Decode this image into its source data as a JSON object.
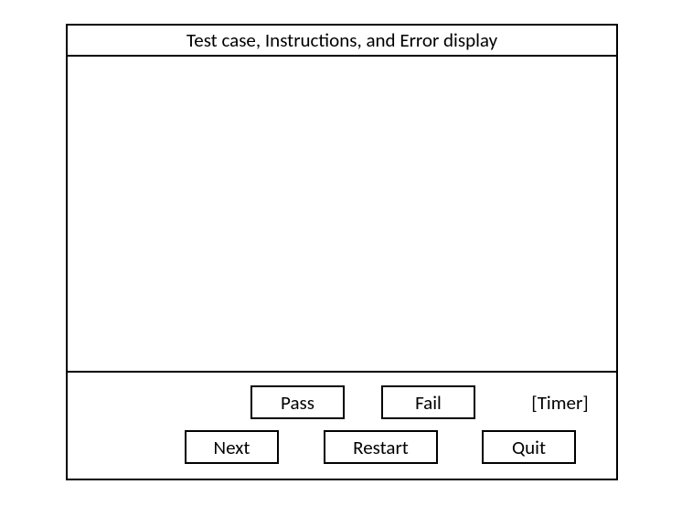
{
  "header": {
    "title": "Test case, Instructions, and Error display"
  },
  "controls": {
    "pass_label": "Pass",
    "fail_label": "Fail",
    "timer_label": "[Timer]",
    "next_label": "Next",
    "restart_label": "Restart",
    "quit_label": "Quit"
  }
}
